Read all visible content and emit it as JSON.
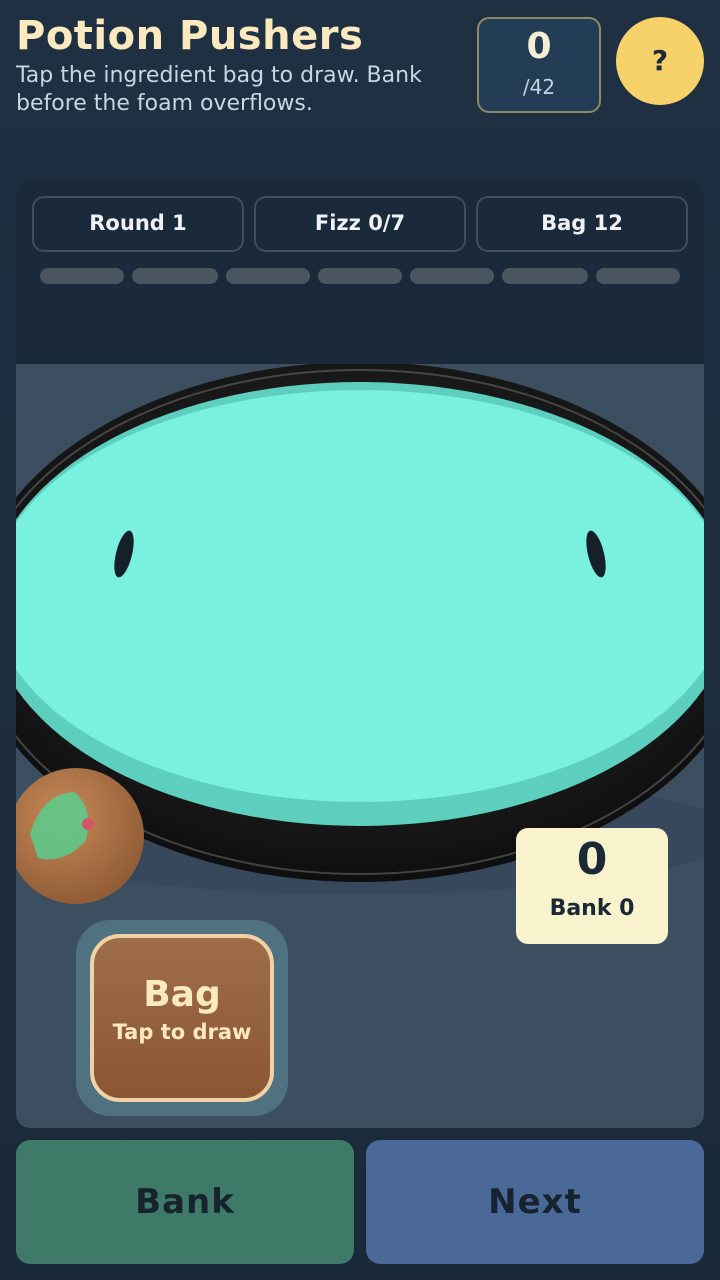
{
  "header": {
    "title": "Potion Pushers",
    "subtitle": "Tap the ingredient bag to draw. Bank before the foam overflows.",
    "score": "0",
    "score_target": "/42",
    "help_label": "?"
  },
  "status": {
    "round": "Round 1",
    "fizz": "Fizz 0/7",
    "bag": "Bag 12"
  },
  "fizz_meter": {
    "filled": 0,
    "total": 7
  },
  "bank_card": {
    "value": "0",
    "label": "Bank 0"
  },
  "bag_button": {
    "title": "Bag",
    "subtitle": "Tap to draw"
  },
  "actions": {
    "bank_label": "Bank",
    "next_label": "Next"
  },
  "colors": {
    "potion": "#7af0de",
    "cauldron_rim": "#1a1a1a",
    "bank_button": "#3e7a67",
    "next_button": "#4a6898",
    "help_button": "#f7d26a",
    "bag_button": "#8a5533"
  }
}
